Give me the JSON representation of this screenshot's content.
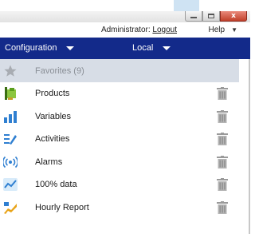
{
  "window": {
    "controls": {
      "minimize": "–",
      "maximize": "□",
      "close": "x"
    }
  },
  "user_bar": {
    "admin_prefix": "Administrator:",
    "logout_label": "Logout",
    "help_label": "Help",
    "help_caret": "▼"
  },
  "nav": {
    "configuration_label": "Configuration",
    "local_label": "Local"
  },
  "favorites": {
    "label": "Favorites (9)",
    "icon": "star-icon"
  },
  "items": [
    {
      "label": "Products",
      "icon": "products-icon"
    },
    {
      "label": "Variables",
      "icon": "bar-chart-icon"
    },
    {
      "label": "Activities",
      "icon": "activities-icon"
    },
    {
      "label": "Alarms",
      "icon": "alarm-signal-icon"
    },
    {
      "label": "100% data",
      "icon": "line-chart-icon"
    },
    {
      "label": "Hourly Report",
      "icon": "report-icon"
    }
  ],
  "colors": {
    "nav_background": "#132a8a",
    "favorites_background": "#d7dde6",
    "close_button": "#c1402a",
    "icon_blue": "#2f7fd1"
  }
}
